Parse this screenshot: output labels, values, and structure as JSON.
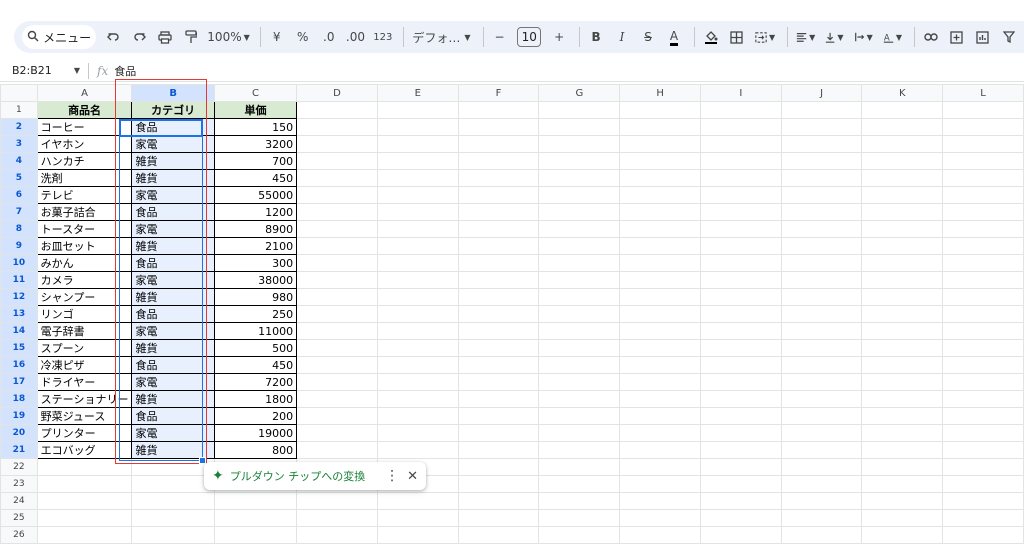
{
  "toolbar": {
    "menu_label": "メニュー",
    "zoom": "100%",
    "currency": "¥",
    "percent": "%",
    "dec_decrease": ".0",
    "dec_increase": ".00",
    "number_format": "123",
    "font": "デフォ…",
    "font_size": "10",
    "minus": "−",
    "plus": "+",
    "bold": "B",
    "italic": "I",
    "strike": "S",
    "text_color": "A"
  },
  "formula_bar": {
    "name_box": "B2:B21",
    "fx": "fx",
    "value": "食品"
  },
  "columns": [
    "A",
    "B",
    "C",
    "D",
    "E",
    "F",
    "G",
    "H",
    "I",
    "J",
    "K",
    "L"
  ],
  "table": {
    "headers": [
      "商品名",
      "カテゴリ",
      "単価"
    ],
    "rows": [
      [
        "コーヒー",
        "食品",
        "150"
      ],
      [
        "イヤホン",
        "家電",
        "3200"
      ],
      [
        "ハンカチ",
        "雑貨",
        "700"
      ],
      [
        "洗剤",
        "雑貨",
        "450"
      ],
      [
        "テレビ",
        "家電",
        "55000"
      ],
      [
        "お菓子詰合",
        "食品",
        "1200"
      ],
      [
        "トースター",
        "家電",
        "8900"
      ],
      [
        "お皿セット",
        "雑貨",
        "2100"
      ],
      [
        "みかん",
        "食品",
        "300"
      ],
      [
        "カメラ",
        "家電",
        "38000"
      ],
      [
        "シャンプー",
        "雑貨",
        "980"
      ],
      [
        "リンゴ",
        "食品",
        "250"
      ],
      [
        "電子辞書",
        "家電",
        "11000"
      ],
      [
        "スプーン",
        "雑貨",
        "500"
      ],
      [
        "冷凍ピザ",
        "食品",
        "450"
      ],
      [
        "ドライヤー",
        "家電",
        "7200"
      ],
      [
        "ステーショナリー",
        "雑貨",
        "1800"
      ],
      [
        "野菜ジュース",
        "食品",
        "200"
      ],
      [
        "プリンター",
        "家電",
        "19000"
      ],
      [
        "エコバッグ",
        "雑貨",
        "800"
      ]
    ]
  },
  "row_numbers": [
    "1",
    "2",
    "3",
    "4",
    "5",
    "6",
    "7",
    "8",
    "9",
    "10",
    "11",
    "12",
    "13",
    "14",
    "15",
    "16",
    "17",
    "18",
    "19",
    "20",
    "21",
    "22",
    "23",
    "24",
    "25",
    "26"
  ],
  "chip": {
    "label": "プルダウン チップへの変換"
  },
  "colors": {
    "header_fill": "#d9ead3",
    "selection": "#1a73e8",
    "annotation": "#e53935",
    "chip_text": "#188038"
  }
}
